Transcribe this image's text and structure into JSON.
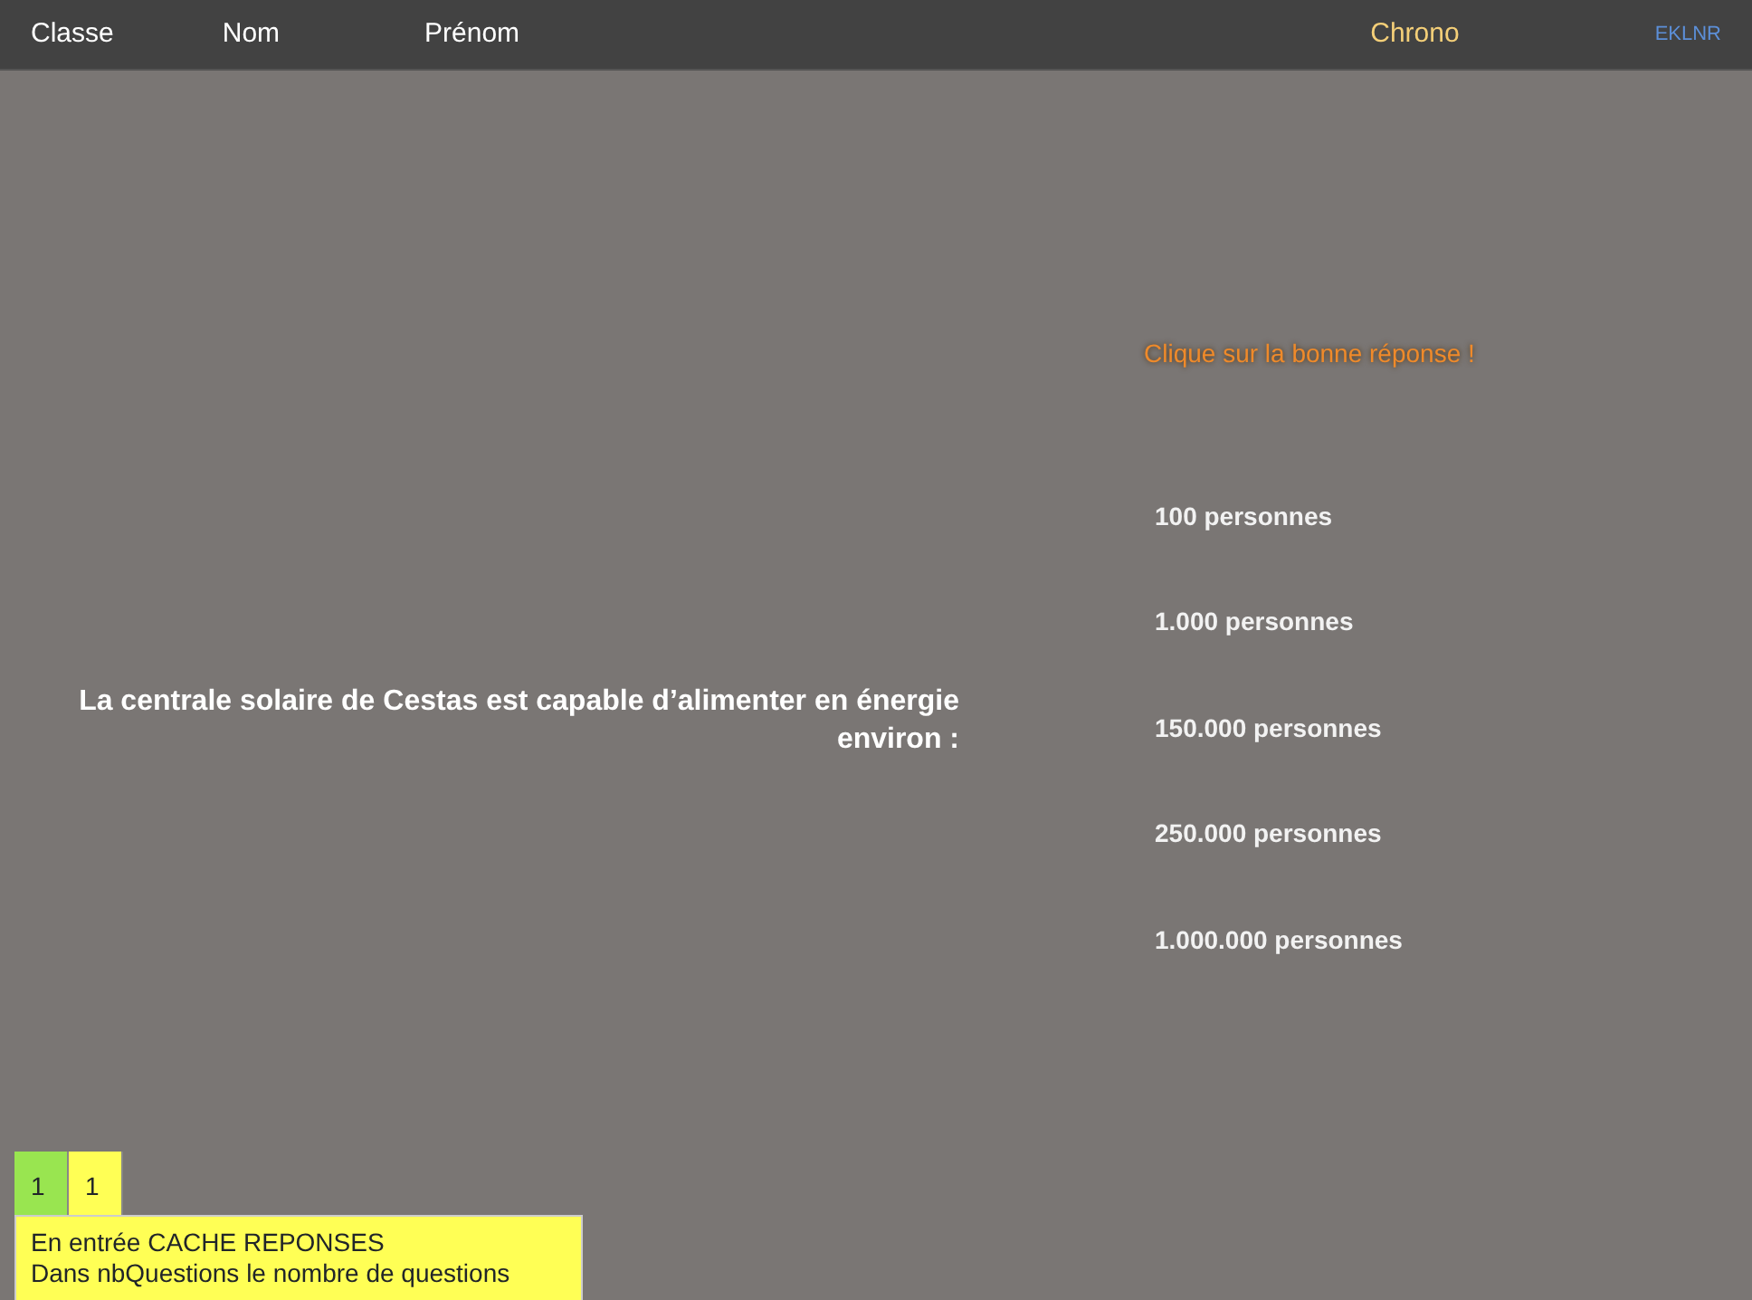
{
  "header": {
    "fields": [
      "Classe",
      "Nom",
      "Prénom"
    ],
    "chrono": "Chrono",
    "code": "EKLNR"
  },
  "instruction": "Clique sur la bonne réponse !",
  "question": "La centrale solaire de Cestas est capable d’alimenter en énergie environ :",
  "answers": [
    "100 personnes",
    "1.000 personnes",
    "150.000 personnes",
    "250.000 personnes",
    "1.000.000 personnes"
  ],
  "counters": [
    {
      "value": "1",
      "color": "#99e550"
    },
    {
      "value": "1",
      "color": "#ffff55"
    }
  ],
  "notes": [
    "En entrée CACHE REPONSES",
    "Dans nbQuestions le nombre de questions"
  ]
}
